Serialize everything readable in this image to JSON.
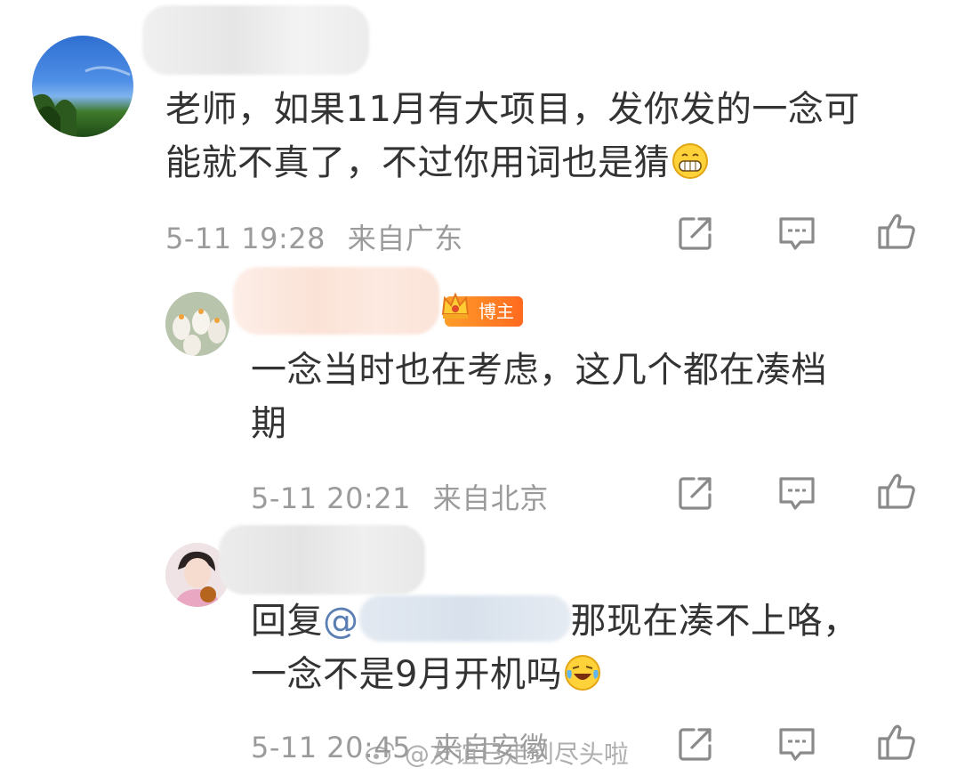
{
  "comments": [
    {
      "text": "老师，如果11月有大项目，发你发的一念可能就不真了，不过你用词也是猜",
      "line1": "老师，如果11月有大项目，发你发的一念可",
      "line2": "能就不真了，不过你用词也是猜",
      "emoji": "grin-emoji",
      "time": "5-11 19:28",
      "location": "来自广东"
    },
    {
      "badge": "博主",
      "line1": "一念当时也在考虑，这几个都在凑档",
      "line2": "期",
      "time": "5-11 20:21",
      "location": "来自北京"
    },
    {
      "reply_prefix": "回复",
      "mention": "@",
      "line1_tail": "那现在凑不上咯，",
      "line2": "一念不是9月开机吗",
      "emoji": "laugh-cry-emoji",
      "time": "5-11 20:45",
      "location": "来自安徽"
    }
  ],
  "actions": {
    "share_icon": "share-icon",
    "comment_icon": "comment-icon",
    "like_icon": "thumbs-up-icon"
  },
  "watermark": "@友谊已走到尽头啦",
  "colors": {
    "text": "#333333",
    "meta": "#9b9b9b",
    "mention": "#5b7eb3",
    "badge": "#ff7a22"
  }
}
